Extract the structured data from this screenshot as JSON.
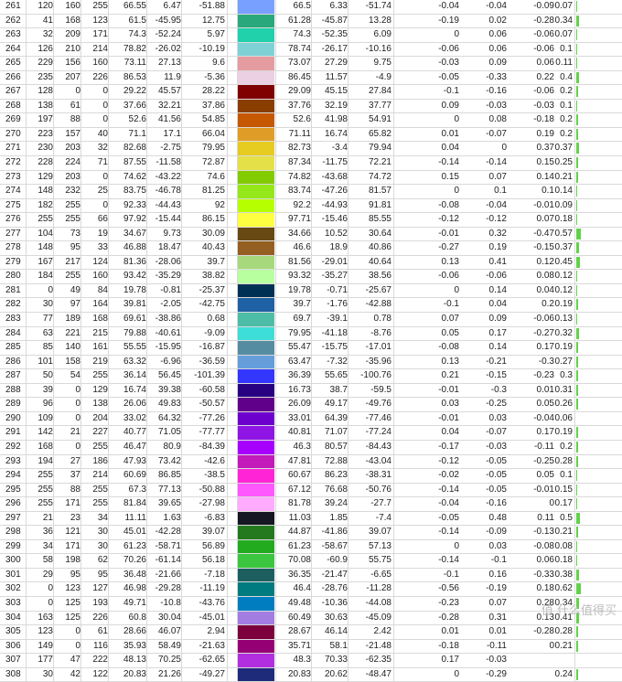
{
  "accent_bar_color": "#62d14a",
  "watermark": "值 什么值得买",
  "rows": [
    {
      "id": "261",
      "r": "120",
      "g": "160",
      "b": "255",
      "L": "66.55",
      "a": "6.47",
      "bb": "-51.88",
      "swatch": "#78a0ff",
      "L2": "66.5",
      "a2": "6.33",
      "b2": "-51.74",
      "d1": "-0.04",
      "d2": "-0.04",
      "d3": "-0.09",
      "de": "0.07",
      "bar": 0.07
    },
    {
      "id": "262",
      "r": "41",
      "g": "168",
      "b": "123",
      "L": "61.5",
      "a": "-45.95",
      "bb": "12.75",
      "swatch": "#29a87b",
      "L2": "61.28",
      "a2": "-45.87",
      "b2": "13.28",
      "d1": "-0.19",
      "d2": "0.02",
      "d3": "-0.28",
      "de": "0.34",
      "bar": 0.34
    },
    {
      "id": "263",
      "r": "32",
      "g": "209",
      "b": "171",
      "L": "74.3",
      "a": "-52.24",
      "bb": "5.97",
      "swatch": "#20d1ab",
      "L2": "74.3",
      "a2": "-52.35",
      "b2": "6.09",
      "d1": "0",
      "d2": "0.06",
      "d3": "-0.06",
      "de": "0.07",
      "bar": 0.07
    },
    {
      "id": "264",
      "r": "126",
      "g": "210",
      "b": "214",
      "L": "78.82",
      "a": "-26.02",
      "bb": "-10.19",
      "swatch": "#7ed2d6",
      "L2": "78.74",
      "a2": "-26.17",
      "b2": "-10.16",
      "d1": "-0.06",
      "d2": "0.06",
      "d3": "-0.06",
      "de": "0.1",
      "bar": 0.1
    },
    {
      "id": "265",
      "r": "229",
      "g": "156",
      "b": "160",
      "L": "73.11",
      "a": "27.13",
      "bb": "9.6",
      "swatch": "#e59ca0",
      "L2": "73.07",
      "a2": "27.29",
      "b2": "9.75",
      "d1": "-0.03",
      "d2": "0.09",
      "d3": "0.06",
      "de": "0.11",
      "bar": 0.11
    },
    {
      "id": "266",
      "r": "235",
      "g": "207",
      "b": "226",
      "L": "86.53",
      "a": "11.9",
      "bb": "-5.36",
      "swatch": "#ebcfe2",
      "L2": "86.45",
      "a2": "11.57",
      "b2": "-4.9",
      "d1": "-0.05",
      "d2": "-0.33",
      "d3": "0.22",
      "de": "0.4",
      "bar": 0.4
    },
    {
      "id": "267",
      "r": "128",
      "g": "0",
      "b": "0",
      "L": "29.22",
      "a": "45.57",
      "bb": "28.22",
      "swatch": "#800000",
      "L2": "29.09",
      "a2": "45.15",
      "b2": "27.84",
      "d1": "-0.1",
      "d2": "-0.16",
      "d3": "-0.06",
      "de": "0.2",
      "bar": 0.2
    },
    {
      "id": "268",
      "r": "138",
      "g": "61",
      "b": "0",
      "L": "37.66",
      "a": "32.21",
      "bb": "37.86",
      "swatch": "#8a3d00",
      "L2": "37.76",
      "a2": "32.19",
      "b2": "37.77",
      "d1": "0.09",
      "d2": "-0.03",
      "d3": "-0.03",
      "de": "0.1",
      "bar": 0.1
    },
    {
      "id": "269",
      "r": "197",
      "g": "88",
      "b": "0",
      "L": "52.6",
      "a": "41.56",
      "bb": "54.85",
      "swatch": "#c55800",
      "L2": "52.6",
      "a2": "41.98",
      "b2": "54.91",
      "d1": "0",
      "d2": "0.08",
      "d3": "-0.18",
      "de": "0.2",
      "bar": 0.2
    },
    {
      "id": "270",
      "r": "223",
      "g": "157",
      "b": "40",
      "L": "71.1",
      "a": "17.1",
      "bb": "66.04",
      "swatch": "#df9d28",
      "L2": "71.11",
      "a2": "16.74",
      "b2": "65.82",
      "d1": "0.01",
      "d2": "-0.07",
      "d3": "0.19",
      "de": "0.2",
      "bar": 0.2
    },
    {
      "id": "271",
      "r": "230",
      "g": "203",
      "b": "32",
      "L": "82.68",
      "a": "-2.75",
      "bb": "79.95",
      "swatch": "#e6cb20",
      "L2": "82.73",
      "a2": "-3.4",
      "b2": "79.94",
      "d1": "0.04",
      "d2": "0",
      "d3": "0.37",
      "de": "0.37",
      "bar": 0.37
    },
    {
      "id": "272",
      "r": "228",
      "g": "224",
      "b": "71",
      "L": "87.55",
      "a": "-11.58",
      "bb": "72.87",
      "swatch": "#e4e047",
      "L2": "87.34",
      "a2": "-11.75",
      "b2": "72.21",
      "d1": "-0.14",
      "d2": "-0.14",
      "d3": "0.15",
      "de": "0.25",
      "bar": 0.25
    },
    {
      "id": "273",
      "r": "129",
      "g": "203",
      "b": "0",
      "L": "74.62",
      "a": "-43.22",
      "bb": "74.6",
      "swatch": "#81cb00",
      "L2": "74.82",
      "a2": "-43.68",
      "b2": "74.72",
      "d1": "0.15",
      "d2": "0.07",
      "d3": "0.14",
      "de": "0.21",
      "bar": 0.21
    },
    {
      "id": "274",
      "r": "148",
      "g": "232",
      "b": "25",
      "L": "83.75",
      "a": "-46.78",
      "bb": "81.25",
      "swatch": "#94e819",
      "L2": "83.74",
      "a2": "-47.26",
      "b2": "81.57",
      "d1": "0",
      "d2": "0.1",
      "d3": "0.1",
      "de": "0.14",
      "bar": 0.14
    },
    {
      "id": "275",
      "r": "182",
      "g": "255",
      "b": "0",
      "L": "92.33",
      "a": "-44.43",
      "bb": "92",
      "swatch": "#b6ff00",
      "L2": "92.2",
      "a2": "-44.93",
      "b2": "91.81",
      "d1": "-0.08",
      "d2": "-0.04",
      "d3": "-0.01",
      "de": "0.09",
      "bar": 0.09
    },
    {
      "id": "276",
      "r": "255",
      "g": "255",
      "b": "66",
      "L": "97.92",
      "a": "-15.44",
      "bb": "86.15",
      "swatch": "#ffff42",
      "L2": "97.71",
      "a2": "-15.46",
      "b2": "85.55",
      "d1": "-0.12",
      "d2": "-0.12",
      "d3": "0.07",
      "de": "0.18",
      "bar": 0.18
    },
    {
      "id": "277",
      "r": "104",
      "g": "73",
      "b": "19",
      "L": "34.67",
      "a": "9.73",
      "bb": "30.09",
      "swatch": "#684913",
      "L2": "34.66",
      "a2": "10.52",
      "b2": "30.64",
      "d1": "-0.01",
      "d2": "0.32",
      "d3": "-0.47",
      "de": "0.57",
      "bar": 0.57
    },
    {
      "id": "278",
      "r": "148",
      "g": "95",
      "b": "33",
      "L": "46.88",
      "a": "18.47",
      "bb": "40.43",
      "swatch": "#945f21",
      "L2": "46.6",
      "a2": "18.9",
      "b2": "40.86",
      "d1": "-0.27",
      "d2": "0.19",
      "d3": "-0.15",
      "de": "0.37",
      "bar": 0.37
    },
    {
      "id": "279",
      "r": "167",
      "g": "217",
      "b": "124",
      "L": "81.36",
      "a": "-28.06",
      "bb": "39.7",
      "swatch": "#a7d97c",
      "L2": "81.56",
      "a2": "-29.01",
      "b2": "40.64",
      "d1": "0.13",
      "d2": "0.41",
      "d3": "0.12",
      "de": "0.45",
      "bar": 0.45
    },
    {
      "id": "280",
      "r": "184",
      "g": "255",
      "b": "160",
      "L": "93.42",
      "a": "-35.29",
      "bb": "38.82",
      "swatch": "#b8ffa0",
      "L2": "93.32",
      "a2": "-35.27",
      "b2": "38.56",
      "d1": "-0.06",
      "d2": "-0.06",
      "d3": "0.08",
      "de": "0.12",
      "bar": 0.12
    },
    {
      "id": "281",
      "r": "0",
      "g": "49",
      "b": "84",
      "L": "19.78",
      "a": "-0.81",
      "bb": "-25.37",
      "swatch": "#003154",
      "L2": "19.78",
      "a2": "-0.71",
      "b2": "-25.67",
      "d1": "0",
      "d2": "0.14",
      "d3": "0.04",
      "de": "0.12",
      "bar": 0.12
    },
    {
      "id": "282",
      "r": "30",
      "g": "97",
      "b": "164",
      "L": "39.81",
      "a": "-2.05",
      "bb": "-42.75",
      "swatch": "#1e61a4",
      "L2": "39.7",
      "a2": "-1.76",
      "b2": "-42.88",
      "d1": "-0.1",
      "d2": "0.04",
      "d3": "0.2",
      "de": "0.19",
      "bar": 0.19
    },
    {
      "id": "283",
      "r": "77",
      "g": "189",
      "b": "168",
      "L": "69.61",
      "a": "-38.86",
      "bb": "0.68",
      "swatch": "#4dbda8",
      "L2": "69.7",
      "a2": "-39.1",
      "b2": "0.78",
      "d1": "0.07",
      "d2": "0.09",
      "d3": "-0.06",
      "de": "0.13",
      "bar": 0.13
    },
    {
      "id": "284",
      "r": "63",
      "g": "221",
      "b": "215",
      "L": "79.88",
      "a": "-40.61",
      "bb": "-9.09",
      "swatch": "#3fddd7",
      "L2": "79.95",
      "a2": "-41.18",
      "b2": "-8.76",
      "d1": "0.05",
      "d2": "0.17",
      "d3": "-0.27",
      "de": "0.32",
      "bar": 0.32
    },
    {
      "id": "285",
      "r": "85",
      "g": "140",
      "b": "161",
      "L": "55.55",
      "a": "-15.95",
      "bb": "-16.87",
      "swatch": "#558ca1",
      "L2": "55.47",
      "a2": "-15.75",
      "b2": "-17.01",
      "d1": "-0.08",
      "d2": "0.14",
      "d3": "0.17",
      "de": "0.19",
      "bar": 0.19
    },
    {
      "id": "286",
      "r": "101",
      "g": "158",
      "b": "219",
      "L": "63.32",
      "a": "-6.96",
      "bb": "-36.59",
      "swatch": "#659edb",
      "L2": "63.47",
      "a2": "-7.32",
      "b2": "-35.96",
      "d1": "0.13",
      "d2": "-0.21",
      "d3": "-0.3",
      "de": "0.27",
      "bar": 0.27
    },
    {
      "id": "287",
      "r": "50",
      "g": "54",
      "b": "255",
      "L": "36.14",
      "a": "56.45",
      "bb": "-101.39",
      "swatch": "#3236ff",
      "L2": "36.39",
      "a2": "55.65",
      "b2": "-100.76",
      "d1": "0.21",
      "d2": "-0.15",
      "d3": "-0.23",
      "de": "0.3",
      "bar": 0.3
    },
    {
      "id": "288",
      "r": "39",
      "g": "0",
      "b": "129",
      "L": "16.74",
      "a": "39.38",
      "bb": "-60.58",
      "swatch": "#270081",
      "L2": "16.73",
      "a2": "38.7",
      "b2": "-59.5",
      "d1": "-0.01",
      "d2": "-0.3",
      "d3": "0.01",
      "de": "0.31",
      "bar": 0.31
    },
    {
      "id": "289",
      "r": "96",
      "g": "0",
      "b": "138",
      "L": "26.06",
      "a": "49.83",
      "bb": "-50.57",
      "swatch": "#60008a",
      "L2": "26.09",
      "a2": "49.17",
      "b2": "-49.76",
      "d1": "0.03",
      "d2": "-0.25",
      "d3": "0.05",
      "de": "0.26",
      "bar": 0.26
    },
    {
      "id": "290",
      "r": "109",
      "g": "0",
      "b": "204",
      "L": "33.02",
      "a": "64.32",
      "bb": "-77.26",
      "swatch": "#6d00cc",
      "L2": "33.01",
      "a2": "64.39",
      "b2": "-77.46",
      "d1": "-0.01",
      "d2": "0.03",
      "d3": "-0.04",
      "de": "0.06",
      "bar": 0.06
    },
    {
      "id": "291",
      "r": "142",
      "g": "21",
      "b": "227",
      "L": "40.77",
      "a": "71.05",
      "bb": "-77.77",
      "swatch": "#8e15e3",
      "L2": "40.81",
      "a2": "71.07",
      "b2": "-77.24",
      "d1": "0.04",
      "d2": "-0.07",
      "d3": "0.17",
      "de": "0.19",
      "bar": 0.19
    },
    {
      "id": "292",
      "r": "168",
      "g": "0",
      "b": "255",
      "L": "46.47",
      "a": "80.9",
      "bb": "-84.39",
      "swatch": "#a800ff",
      "L2": "46.3",
      "a2": "80.57",
      "b2": "-84.43",
      "d1": "-0.17",
      "d2": "-0.03",
      "d3": "-0.11",
      "de": "0.2",
      "bar": 0.2
    },
    {
      "id": "293",
      "r": "194",
      "g": "27",
      "b": "186",
      "L": "47.93",
      "a": "73.42",
      "bb": "-42.6",
      "swatch": "#c21bba",
      "L2": "47.81",
      "a2": "72.88",
      "b2": "-43.04",
      "d1": "-0.12",
      "d2": "-0.05",
      "d3": "-0.25",
      "de": "0.28",
      "bar": 0.28
    },
    {
      "id": "294",
      "r": "255",
      "g": "37",
      "b": "214",
      "L": "60.69",
      "a": "86.85",
      "bb": "-38.5",
      "swatch": "#ff25d6",
      "L2": "60.67",
      "a2": "86.23",
      "b2": "-38.31",
      "d1": "-0.02",
      "d2": "-0.05",
      "d3": "0.05",
      "de": "0.1",
      "bar": 0.1
    },
    {
      "id": "295",
      "r": "255",
      "g": "88",
      "b": "255",
      "L": "67.3",
      "a": "77.13",
      "bb": "-50.88",
      "swatch": "#ff58ff",
      "L2": "67.12",
      "a2": "76.68",
      "b2": "-50.76",
      "d1": "-0.14",
      "d2": "-0.05",
      "d3": "-0.01",
      "de": "0.15",
      "bar": 0.15
    },
    {
      "id": "296",
      "r": "255",
      "g": "171",
      "b": "255",
      "L": "81.84",
      "a": "39.65",
      "bb": "-27.98",
      "swatch": "#ffabff",
      "L2": "81.78",
      "a2": "39.24",
      "b2": "-27.7",
      "d1": "-0.04",
      "d2": "-0.16",
      "d3": "0",
      "de": "0.17",
      "bar": 0.17
    },
    {
      "id": "297",
      "r": "21",
      "g": "23",
      "b": "34",
      "L": "11.11",
      "a": "1.63",
      "bb": "-6.83",
      "swatch": "#151722",
      "L2": "11.03",
      "a2": "1.85",
      "b2": "-7.4",
      "d1": "-0.05",
      "d2": "0.48",
      "d3": "0.11",
      "de": "0.5",
      "bar": 0.5
    },
    {
      "id": "298",
      "r": "36",
      "g": "121",
      "b": "30",
      "L": "45.01",
      "a": "-42.28",
      "bb": "39.07",
      "swatch": "#24791e",
      "L2": "44.87",
      "a2": "-41.86",
      "b2": "39.07",
      "d1": "-0.14",
      "d2": "-0.09",
      "d3": "-0.13",
      "de": "0.21",
      "bar": 0.21
    },
    {
      "id": "299",
      "r": "34",
      "g": "171",
      "b": "30",
      "L": "61.23",
      "a": "-58.71",
      "bb": "56.89",
      "swatch": "#22ab1e",
      "L2": "61.23",
      "a2": "-58.67",
      "b2": "57.13",
      "d1": "0",
      "d2": "0.03",
      "d3": "-0.08",
      "de": "0.08",
      "bar": 0.08
    },
    {
      "id": "300",
      "r": "58",
      "g": "198",
      "b": "62",
      "L": "70.26",
      "a": "-61.14",
      "bb": "56.18",
      "swatch": "#3ac63e",
      "L2": "70.08",
      "a2": "-60.9",
      "b2": "55.75",
      "d1": "-0.14",
      "d2": "-0.1",
      "d3": "0.06",
      "de": "0.18",
      "bar": 0.18
    },
    {
      "id": "301",
      "r": "29",
      "g": "95",
      "b": "95",
      "L": "36.48",
      "a": "-21.66",
      "bb": "-7.18",
      "swatch": "#1d5f5f",
      "L2": "36.35",
      "a2": "-21.47",
      "b2": "-6.65",
      "d1": "-0.1",
      "d2": "0.16",
      "d3": "-0.33",
      "de": "0.38",
      "bar": 0.38
    },
    {
      "id": "302",
      "r": "0",
      "g": "123",
      "b": "127",
      "L": "46.98",
      "a": "-29.28",
      "bb": "-11.19",
      "swatch": "#007b7f",
      "L2": "46.4",
      "a2": "-28.76",
      "b2": "-11.28",
      "d1": "-0.56",
      "d2": "-0.19",
      "d3": "0.18",
      "de": "0.62",
      "bar": 0.62
    },
    {
      "id": "303",
      "r": "0",
      "g": "125",
      "b": "193",
      "L": "49.71",
      "a": "-10.8",
      "bb": "-43.76",
      "swatch": "#007dc1",
      "L2": "49.48",
      "a2": "-10.36",
      "b2": "-44.08",
      "d1": "-0.23",
      "d2": "0.07",
      "d3": "0.28",
      "de": "0.34",
      "bar": 0.34
    },
    {
      "id": "304",
      "r": "163",
      "g": "125",
      "b": "226",
      "L": "60.8",
      "a": "30.04",
      "bb": "-45.01",
      "swatch": "#a37de2",
      "L2": "60.49",
      "a2": "30.63",
      "b2": "-45.09",
      "d1": "-0.28",
      "d2": "0.31",
      "d3": "0.13",
      "de": "0.41",
      "bar": 0.41
    },
    {
      "id": "305",
      "r": "123",
      "g": "0",
      "b": "61",
      "L": "28.66",
      "a": "46.07",
      "bb": "2.94",
      "swatch": "#7b003d",
      "L2": "28.67",
      "a2": "46.14",
      "b2": "2.42",
      "d1": "0.01",
      "d2": "0.01",
      "d3": "-0.28",
      "de": "0.28",
      "bar": 0.28
    },
    {
      "id": "306",
      "r": "149",
      "g": "0",
      "b": "116",
      "L": "35.93",
      "a": "58.49",
      "bb": "-21.63",
      "swatch": "#950074",
      "L2": "35.71",
      "a2": "58.1",
      "b2": "-21.48",
      "d1": "-0.18",
      "d2": "-0.11",
      "d3": "0",
      "de": "0.21",
      "bar": 0.21
    },
    {
      "id": "307",
      "r": "177",
      "g": "47",
      "b": "222",
      "L": "48.13",
      "a": "70.25",
      "bb": "-62.65",
      "swatch": "#b12fde",
      "L2": "48.3",
      "a2": "70.33",
      "b2": "-62.35",
      "d1": "0.17",
      "d2": "-0.03",
      "d3": "",
      "de": "",
      "bar": 0
    },
    {
      "id": "308",
      "r": "30",
      "g": "42",
      "b": "122",
      "L": "20.83",
      "a": "21.26",
      "bb": "-49.27",
      "swatch": "#1e2a7a",
      "L2": "20.83",
      "a2": "20.62",
      "b2": "-48.47",
      "d1": "0",
      "d2": "-0.29",
      "d3": "",
      "de": "0.24",
      "bar": 0.24
    }
  ]
}
